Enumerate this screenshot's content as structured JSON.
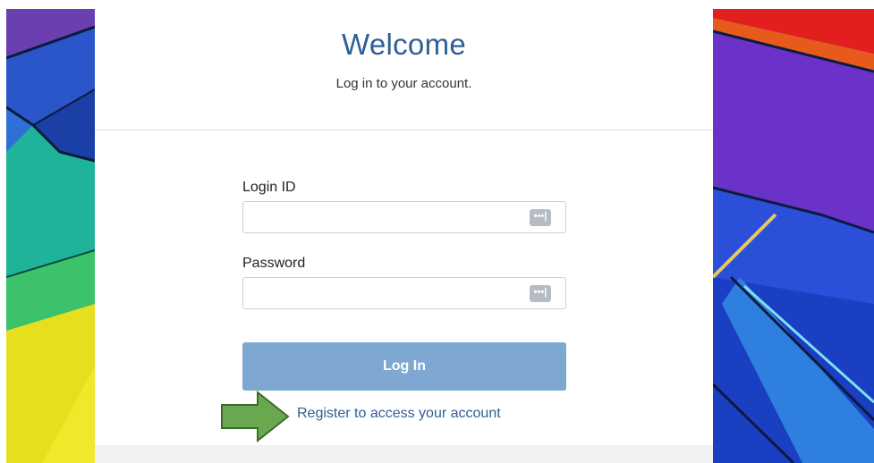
{
  "header": {
    "title": "Welcome",
    "subtitle": "Log in to your account."
  },
  "form": {
    "login_id": {
      "label": "Login ID",
      "value": "",
      "placeholder": "",
      "icon": "password-manager-icon"
    },
    "password": {
      "label": "Password",
      "value": "",
      "placeholder": "",
      "icon": "password-manager-icon"
    },
    "login_button_label": "Log In",
    "register_link": "Register to access your account"
  },
  "icons": {
    "field_icon_glyph": "•••|"
  },
  "colors": {
    "accent": "#2e5f95",
    "button": "#7ea8d2",
    "arrow": "#6aa84f"
  }
}
